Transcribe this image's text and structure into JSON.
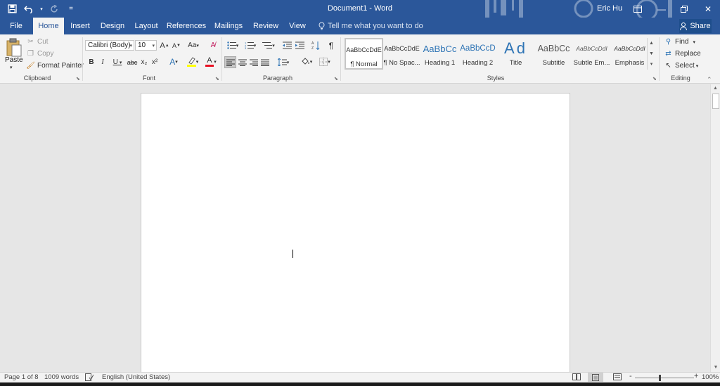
{
  "titlebar": {
    "doc_title": "Document1  -  Word",
    "user": "Eric Hu",
    "bg_color": "#2b579a",
    "qat": [
      {
        "name": "save-icon",
        "glyph": "🖫"
      },
      {
        "name": "undo-icon",
        "glyph": "↶"
      },
      {
        "name": "redo-icon",
        "glyph": "↻"
      },
      {
        "name": "customize-qat-icon",
        "glyph": "="
      }
    ]
  },
  "tabs": [
    "File",
    "Home",
    "Insert",
    "Design",
    "Layout",
    "References",
    "Mailings",
    "Review",
    "View"
  ],
  "active_tab": "Home",
  "tell_me": "Tell me what you want to do",
  "share": "Share",
  "ribbon": {
    "clipboard": {
      "label": "Clipboard",
      "paste": "Paste",
      "cut": "Cut",
      "copy": "Copy",
      "format_painter": "Format Painter"
    },
    "font": {
      "label": "Font",
      "family": "Calibri (Body)",
      "size": "10",
      "grow": "A",
      "shrink": "A",
      "change_case": "Aa",
      "bold": "B",
      "italic": "I",
      "underline": "U",
      "strike": "abc",
      "subscript": "x₂",
      "superscript": "x²",
      "font_color_letter": "A",
      "font_color": "#e81123",
      "highlight_color": "#ffff00"
    },
    "paragraph": {
      "label": "Paragraph",
      "pilcrow": "¶"
    },
    "styles": {
      "label": "Styles",
      "items": [
        {
          "sample": "AaBbCcDdE",
          "name": "¶ Normal",
          "selected": true
        },
        {
          "sample": "AaBbCcDdE",
          "name": "¶ No Spac..."
        },
        {
          "sample": "AaBbCc",
          "name": "Heading 1"
        },
        {
          "sample": "AaBbCcD",
          "name": "Heading 2"
        },
        {
          "sample": "Ad",
          "name": "Title"
        },
        {
          "sample": "AaBbCc",
          "name": "Subtitle"
        },
        {
          "sample": "AaBbCcDdI",
          "name": "Subtle Em..."
        },
        {
          "sample": "AaBbCcDdI",
          "name": "Emphasis"
        }
      ],
      "heading_color": "#2e74b5"
    },
    "editing": {
      "label": "Editing",
      "find": "Find",
      "replace": "Replace",
      "select": "Select"
    }
  },
  "status": {
    "page": "Page 1 of 8",
    "words": "1009 words",
    "language": "English (United States)",
    "zoom": "100%",
    "zoom_minus": "-",
    "zoom_plus": "+"
  }
}
